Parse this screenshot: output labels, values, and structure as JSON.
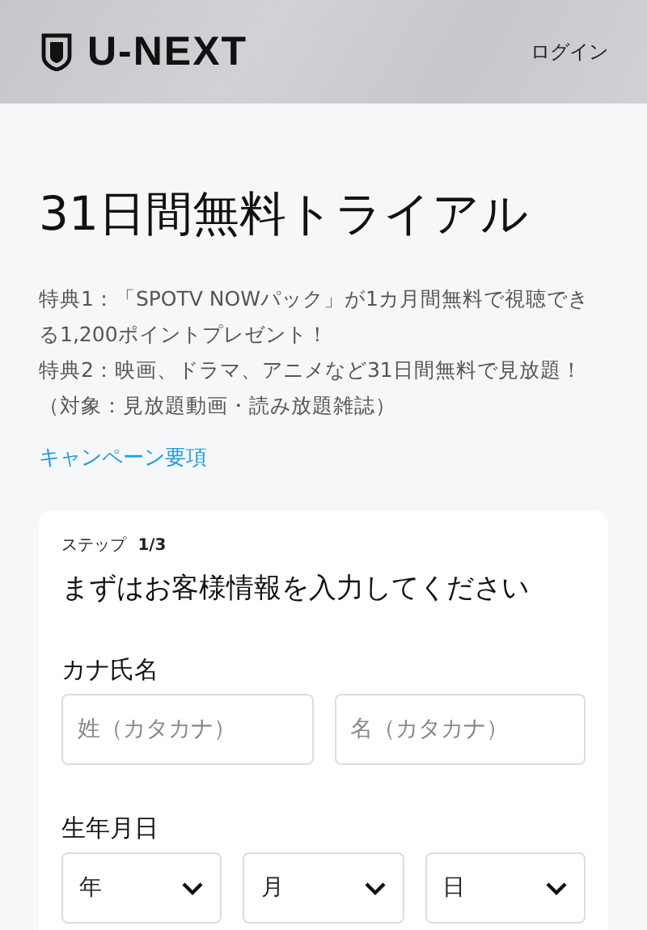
{
  "header": {
    "logo": "U-NEXT",
    "login": "ログイン"
  },
  "title": "31日間無料トライアル",
  "benefits": [
    "特典1：「SPOTV NOWパック」が1カ月間無料で視聴できる1,200ポイントプレゼント！",
    "特典2：映画、ドラマ、アニメなど31日間無料で見放題！（対象：見放題動画・読み放題雑誌）"
  ],
  "campaign_link": "キャンペーン要項",
  "form": {
    "step_label": "ステップ",
    "step": "1/3",
    "heading": "まずはお客様情報を入力してください",
    "name_label": "カナ氏名",
    "name_fields": [
      {
        "placeholder": "姓（カタカナ）"
      },
      {
        "placeholder": "名（カタカナ）"
      }
    ],
    "birth_label": "生年月日",
    "birth_selects": [
      {
        "value": "年"
      },
      {
        "value": "月"
      },
      {
        "value": "日"
      }
    ]
  }
}
